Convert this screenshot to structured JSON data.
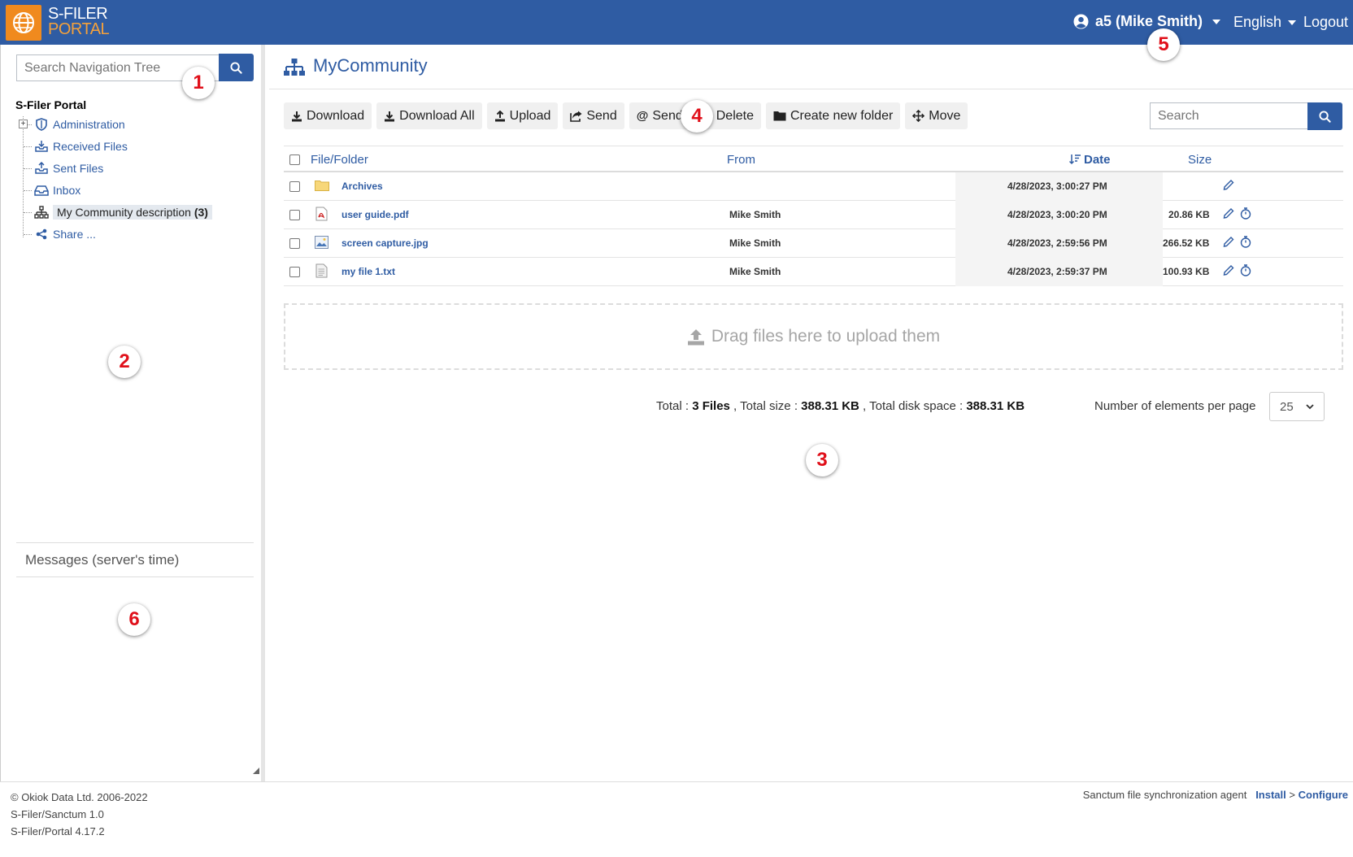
{
  "header": {
    "logo_line1": "S-FILER",
    "logo_line2": "PORTAL",
    "user_label": "a5 (Mike Smith)",
    "language": "English",
    "logout": "Logout"
  },
  "sidebar": {
    "search_placeholder": "Search Navigation Tree",
    "root": "S-Filer Portal",
    "items": [
      {
        "label": "Administration",
        "icon": "shield-icon"
      },
      {
        "label": "Received Files",
        "icon": "inbox-download-icon"
      },
      {
        "label": "Sent Files",
        "icon": "inbox-upload-icon"
      },
      {
        "label": "Inbox",
        "icon": "inbox-icon"
      },
      {
        "label": "My Community description",
        "count": "(3)",
        "icon": "sitemap-icon"
      },
      {
        "label": "Share ...",
        "icon": "share-icon"
      }
    ],
    "messages_title": "Messages (server's time)"
  },
  "main": {
    "title": "MyCommunity",
    "toolbar": {
      "download": "Download",
      "download_all": "Download All",
      "upload": "Upload",
      "send": "Send",
      "send_email": "Send",
      "delete": "Delete",
      "create_folder": "Create new folder",
      "move": "Move"
    },
    "search_placeholder": "Search",
    "columns": {
      "file": "File/Folder",
      "from": "From",
      "date": "Date",
      "size": "Size"
    },
    "rows": [
      {
        "name": "Archives",
        "from": "",
        "date": "4/28/2023, 3:00:27 PM",
        "size": "",
        "type": "folder"
      },
      {
        "name": "user guide.pdf",
        "from": "Mike Smith",
        "date": "4/28/2023, 3:00:20 PM",
        "size": "20.86 KB",
        "type": "pdf"
      },
      {
        "name": "screen capture.jpg",
        "from": "Mike Smith",
        "date": "4/28/2023, 2:59:56 PM",
        "size": "266.52 KB",
        "type": "image"
      },
      {
        "name": "my file 1.txt",
        "from": "Mike Smith",
        "date": "4/28/2023, 2:59:37 PM",
        "size": "100.93 KB",
        "type": "text"
      }
    ],
    "dropzone": "Drag files here to upload them",
    "summary": {
      "total_label": "Total : ",
      "files": "3 Files",
      "size_label": " , Total size : ",
      "size": "388.31 KB",
      "disk_label": " , Total disk space : ",
      "disk": "388.31 KB"
    },
    "per_page_label": "Number of elements per page",
    "per_page_value": "25"
  },
  "footer": {
    "copyright": "© Okiok Data Ltd. 2006-2022",
    "version1": "S-Filer/Sanctum 1.0",
    "version2": "S-Filer/Portal 4.17.2",
    "agent_label": "Sanctum file synchronization agent",
    "install": "Install",
    "sep": ">",
    "configure": "Configure"
  },
  "callouts": [
    "1",
    "2",
    "3",
    "4",
    "5",
    "6"
  ],
  "colors": {
    "brand": "#2f5ca3",
    "logo": "#f08a1e",
    "callout": "#e0101a"
  }
}
